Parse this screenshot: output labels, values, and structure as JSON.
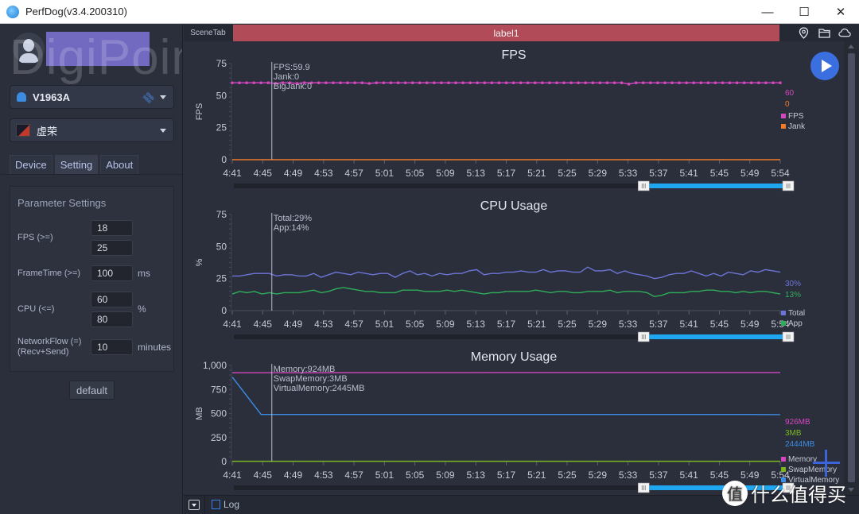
{
  "window": {
    "title": "PerfDog(v3.4.200310)",
    "minimize": "—",
    "maximize": "☐",
    "close": "✕"
  },
  "sidebar": {
    "watermark": "DigiPoint",
    "device": {
      "name": "V1963A",
      "icon": "android-icon"
    },
    "app": {
      "name": "虚荣",
      "icon": "app-thumbnail"
    },
    "tabs": [
      {
        "label": "Device",
        "active": false
      },
      {
        "label": "Setting",
        "active": true
      },
      {
        "label": "About",
        "active": false
      }
    ],
    "params": {
      "title": "Parameter Settings",
      "fps_label": "FPS (>=)",
      "fps_values": [
        "18",
        "25"
      ],
      "frametime_label": "FrameTime (>=)",
      "frametime_value": "100",
      "frametime_unit": "ms",
      "cpu_label": "CPU (<=)",
      "cpu_values": [
        "60",
        "80"
      ],
      "cpu_unit": "%",
      "network_label_1": "NetworkFlow (=)",
      "network_label_2": "(Recv+Send)",
      "network_value": "10",
      "network_unit": "minutes"
    },
    "default_button": "default"
  },
  "topbar": {
    "scene_tab": "SceneTab",
    "label": "label1",
    "icons": [
      "location-pin-icon",
      "folder-icon",
      "cloud-icon"
    ]
  },
  "bottombar": {
    "log_label": "Log",
    "log_checked": false
  },
  "brand_watermark": {
    "glyph": "值",
    "text": "什么值得买"
  },
  "colors": {
    "fps": "#d447c0",
    "jank": "#f07a2a",
    "total": "#6c74d6",
    "app": "#2fae5a",
    "memory": "#d447c0",
    "swap": "#7ab520",
    "virtual": "#3b8de8",
    "label_bar": "#b14b58",
    "accent": "#3b6fe0",
    "slider": "#1ea7f0"
  },
  "chart_data": [
    {
      "type": "line",
      "title": "FPS",
      "ylabel": "FPS",
      "xlabel": "",
      "ylim": [
        0,
        75
      ],
      "yticks": [
        "0",
        "25",
        "50",
        "75"
      ],
      "ytick_values": [
        0,
        25,
        50,
        75
      ],
      "x": [
        "4:41",
        "4:45",
        "4:49",
        "4:53",
        "4:57",
        "5:01",
        "5:05",
        "5:09",
        "5:13",
        "5:17",
        "5:21",
        "5:25",
        "5:29",
        "5:33",
        "5:37",
        "5:41",
        "5:45",
        "5:49",
        "5:54"
      ],
      "cursor_x_index": 1.3,
      "tooltip": [
        "FPS:59.9",
        "Jank:0",
        "BigJank:0"
      ],
      "markers": true,
      "series": [
        {
          "name": "FPS",
          "color_key": "fps",
          "current": "60",
          "values": [
            60,
            60,
            60,
            60,
            60,
            60,
            59.5,
            60,
            60,
            59.5,
            60,
            60,
            60,
            60,
            60,
            60,
            60,
            60,
            60,
            59.5,
            60,
            60,
            60,
            60,
            60,
            60,
            60,
            60,
            60,
            60,
            60,
            60,
            60,
            60,
            60,
            60,
            60,
            60,
            60,
            60,
            60,
            60,
            60,
            60,
            60,
            60,
            60,
            60,
            60,
            60,
            60,
            60,
            60,
            60,
            60,
            59,
            60,
            60,
            60,
            60,
            60,
            60,
            60,
            60,
            60,
            60,
            60,
            60,
            60,
            60,
            60,
            60,
            60,
            60,
            60,
            60,
            60
          ]
        },
        {
          "name": "Jank",
          "color_key": "jank",
          "current": "0",
          "values": [
            0,
            0,
            0,
            0,
            0,
            0,
            0,
            0,
            0,
            0,
            0,
            0,
            0,
            0,
            0,
            0,
            0,
            0,
            0,
            0
          ]
        }
      ]
    },
    {
      "type": "line",
      "title": "CPU Usage",
      "ylabel": "%",
      "xlabel": "",
      "ylim": [
        0,
        75
      ],
      "yticks": [
        "0",
        "25",
        "50",
        "75"
      ],
      "ytick_values": [
        0,
        25,
        50,
        75
      ],
      "x": [
        "4:41",
        "4:45",
        "4:49",
        "4:53",
        "4:57",
        "5:01",
        "5:05",
        "5:09",
        "5:13",
        "5:17",
        "5:21",
        "5:25",
        "5:29",
        "5:33",
        "5:37",
        "5:41",
        "5:45",
        "5:49",
        "5:54"
      ],
      "cursor_x_index": 1.3,
      "tooltip": [
        "Total:29%",
        "App:14%"
      ],
      "markers": false,
      "series": [
        {
          "name": "Total",
          "color_key": "total",
          "current": "30%",
          "values": [
            27,
            27,
            28,
            29,
            29,
            29,
            27,
            28,
            28,
            27,
            27,
            29,
            26,
            28,
            30,
            29,
            28,
            30,
            29,
            28,
            29,
            29,
            26,
            29,
            31,
            28,
            29,
            27,
            29,
            28,
            29,
            29,
            31,
            32,
            28,
            29,
            29,
            30,
            30,
            31,
            30,
            30,
            32,
            30,
            31,
            31,
            30,
            30,
            34,
            31,
            31,
            32,
            29,
            31,
            29,
            28,
            27,
            25,
            26,
            28,
            29,
            29,
            31,
            29,
            27,
            29,
            27,
            30,
            29,
            28,
            31,
            30,
            32,
            31,
            30
          ]
        },
        {
          "name": "App",
          "color_key": "app",
          "current": "13%",
          "values": [
            13,
            15,
            14,
            15,
            13,
            14,
            13,
            14,
            14,
            14,
            15,
            16,
            14,
            15,
            17,
            18,
            17,
            16,
            15,
            15,
            14,
            14,
            14,
            16,
            16,
            16,
            15,
            15,
            15,
            16,
            15,
            16,
            15,
            14,
            13,
            14,
            14,
            15,
            15,
            15,
            15,
            16,
            15,
            14,
            15,
            15,
            14,
            14,
            15,
            15,
            15,
            16,
            14,
            15,
            15,
            15,
            14,
            11,
            12,
            14,
            14,
            14,
            15,
            15,
            16,
            16,
            15,
            15,
            14,
            15,
            14,
            15,
            15,
            14,
            13
          ]
        }
      ]
    },
    {
      "type": "line",
      "title": "Memory Usage",
      "ylabel": "MB",
      "xlabel": "",
      "ylim": [
        0,
        1000
      ],
      "yticks": [
        "0",
        "250",
        "500",
        "750",
        "1,000"
      ],
      "ytick_values": [
        0,
        250,
        500,
        750,
        1000
      ],
      "x": [
        "4:41",
        "4:45",
        "4:49",
        "4:53",
        "4:57",
        "5:01",
        "5:05",
        "5:09",
        "5:13",
        "5:17",
        "5:21",
        "5:25",
        "5:29",
        "5:33",
        "5:37",
        "5:41",
        "5:45",
        "5:49",
        "5:54"
      ],
      "cursor_x_index": 1.3,
      "tooltip": [
        "Memory:924MB",
        "SwapMemory:3MB",
        "VirtualMemory:2445MB"
      ],
      "markers": false,
      "series": [
        {
          "name": "Memory",
          "color_key": "memory",
          "current": "926MB",
          "values": [
            924,
            924,
            924,
            924,
            925,
            925,
            925,
            925,
            925,
            926,
            926,
            926,
            926,
            926,
            926,
            926,
            926,
            926,
            926,
            926
          ]
        },
        {
          "name": "SwapMemory",
          "color_key": "swap",
          "current": "3MB",
          "values": [
            3,
            3,
            3,
            3,
            3,
            3,
            3,
            3,
            3,
            3,
            3,
            3,
            3,
            3,
            3,
            3,
            3,
            3,
            3,
            3
          ]
        },
        {
          "name": "VirtualMemory",
          "color_key": "virtual",
          "current": "2444MB",
          "values": [
            880,
            490,
            490,
            490,
            490,
            490,
            490,
            490,
            490,
            490,
            490,
            490,
            490,
            490,
            490,
            490,
            490,
            490,
            490,
            488
          ]
        }
      ]
    }
  ],
  "range_slider": {
    "start_fraction": 0.74,
    "end_fraction": 1.0
  }
}
